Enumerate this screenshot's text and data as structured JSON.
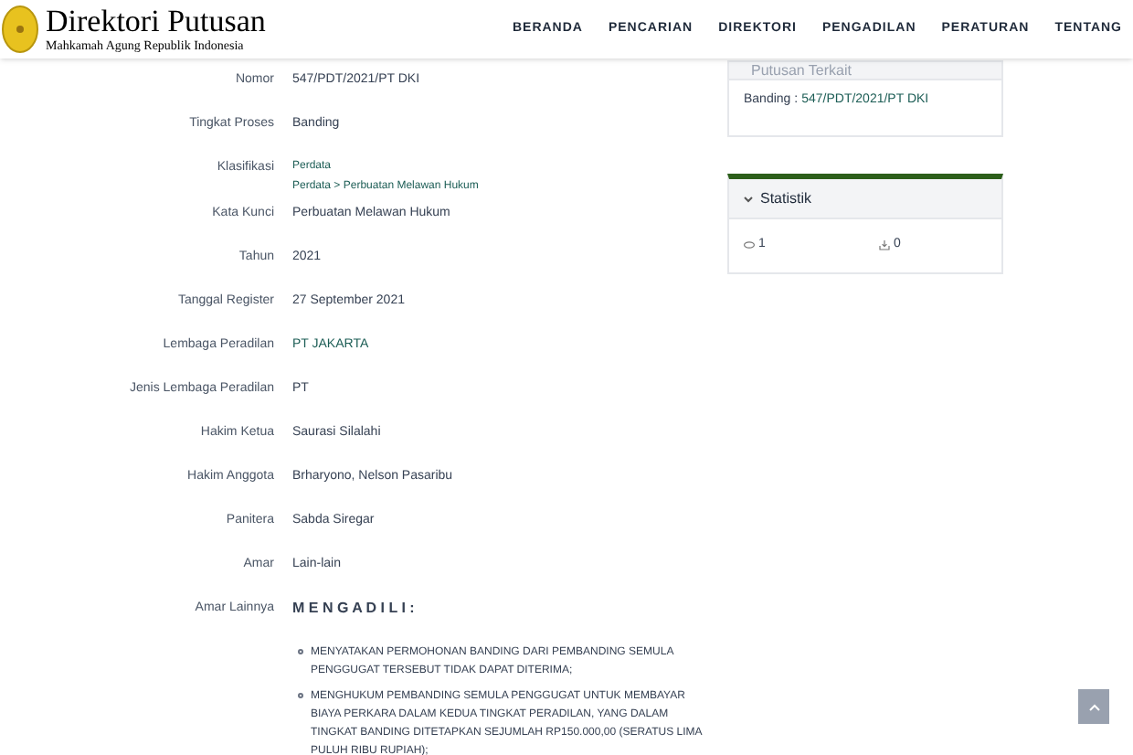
{
  "header": {
    "logo_title": "Direktori Putusan",
    "logo_subtitle": "Mahkamah Agung Republik Indonesia",
    "nav": [
      {
        "label": "BERANDA"
      },
      {
        "label": "PENCARIAN"
      },
      {
        "label": "DIREKTORI"
      },
      {
        "label": "PENGADILAN"
      },
      {
        "label": "PERATURAN"
      },
      {
        "label": "TENTANG"
      }
    ]
  },
  "details": [
    {
      "label": "Nomor",
      "kind": "text",
      "values": [
        "547/PDT/2021/PT DKI"
      ]
    },
    {
      "label": "Tingkat Proses",
      "kind": "text",
      "values": [
        "Banding"
      ]
    },
    {
      "label": "Klasifikasi",
      "kind": "links_small",
      "values": [
        "Perdata",
        "Perdata > Perbuatan Melawan Hukum"
      ]
    },
    {
      "label": "Kata Kunci",
      "kind": "text",
      "values": [
        "Perbuatan Melawan Hukum"
      ]
    },
    {
      "label": "Tahun",
      "kind": "text",
      "values": [
        "2021"
      ]
    },
    {
      "label": "Tanggal Register",
      "kind": "text",
      "values": [
        "27 September 2021"
      ]
    },
    {
      "label": "Lembaga Peradilan",
      "kind": "link",
      "values": [
        "PT JAKARTA"
      ]
    },
    {
      "label": "Jenis Lembaga Peradilan",
      "kind": "text",
      "values": [
        "PT"
      ]
    },
    {
      "label": "Hakim Ketua",
      "kind": "text",
      "values": [
        "Saurasi Silalahi"
      ]
    },
    {
      "label": "Hakim Anggota",
      "kind": "text",
      "values": [
        "Brharyono, Nelson Pasaribu"
      ]
    },
    {
      "label": "Panitera",
      "kind": "text",
      "values": [
        "Sabda Siregar"
      ]
    },
    {
      "label": "Amar",
      "kind": "text",
      "values": [
        "Lain-lain"
      ]
    },
    {
      "label": "Amar Lainnya",
      "kind": "heading",
      "values": [
        "M E N G A D I L I :"
      ]
    }
  ],
  "amar_items": [
    "MENYATAKAN PERMOHONAN BANDING DARI PEMBANDING SEMULA PENGGUGAT TERSEBUT TIDAK DAPAT DITERIMA;",
    "MENGHUKUM PEMBANDING SEMULA PENGGUGAT UNTUK MEMBAYAR BIAYA PERKARA DALAM KEDUA TINGKAT PERADILAN, YANG DALAM TINGKAT BANDING DITETAPKAN SEJUMLAH RP150.000,00 (SERATUS LIMA PULUH RIBU RUPIAH);"
  ],
  "related": {
    "title": "Putusan Terkait",
    "label": "Banding :",
    "link": "547/PDT/2021/PT DKI"
  },
  "stats": {
    "title": "Statistik",
    "views": "1",
    "downloads": "0"
  }
}
